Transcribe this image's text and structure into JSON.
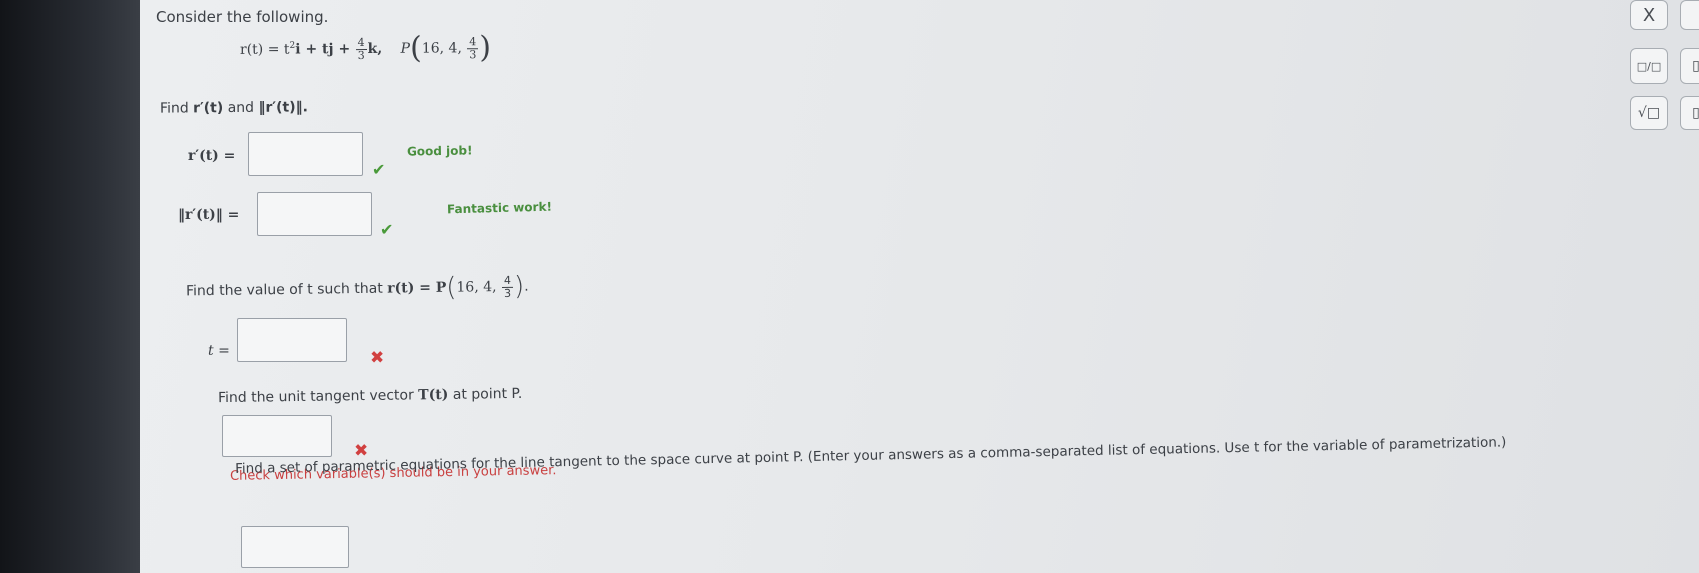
{
  "intro": "Consider the following.",
  "equation": {
    "lhs": "r(t) = t",
    "sq": "2",
    "i": "i + tj +",
    "fnum": "4",
    "fden": "3",
    "k": "k,",
    "point_label": "P",
    "p1": "16, 4,",
    "pnum": "4",
    "pden": "3"
  },
  "q1": {
    "prompt_a": "Find",
    "prompt_b": "r′(t)",
    "prompt_c": "and",
    "prompt_d": "‖r′(t)‖.",
    "label_a": "r′(t) =",
    "feedback_a": "Good job!",
    "label_b": "‖r′(t)‖ =",
    "feedback_b": "Fantastic work!"
  },
  "q2": {
    "prompt": "Find the value of t such that",
    "rt": "r(t) = P",
    "p1": "16, 4,",
    "pnum": "4",
    "pden": "3",
    "label": "t ="
  },
  "q3": {
    "prompt": "Find the unit tangent vector",
    "tvec": "T(t)",
    "tail": "at point P.",
    "feedback": "Check which variable(s) should be in your answer."
  },
  "q4": {
    "prompt": "Find a set of parametric equations for the line tangent to the space curve at point P. (Enter your answers as a comma-separated list of equations. Use t for the variable of parametrization.)"
  },
  "side": {
    "close": "X",
    "frac_btn": "□/□",
    "sqrt_btn": "√□",
    "box1": "▯",
    "box2": "▯"
  },
  "marks": {
    "check": "✔",
    "cross": "✖"
  }
}
